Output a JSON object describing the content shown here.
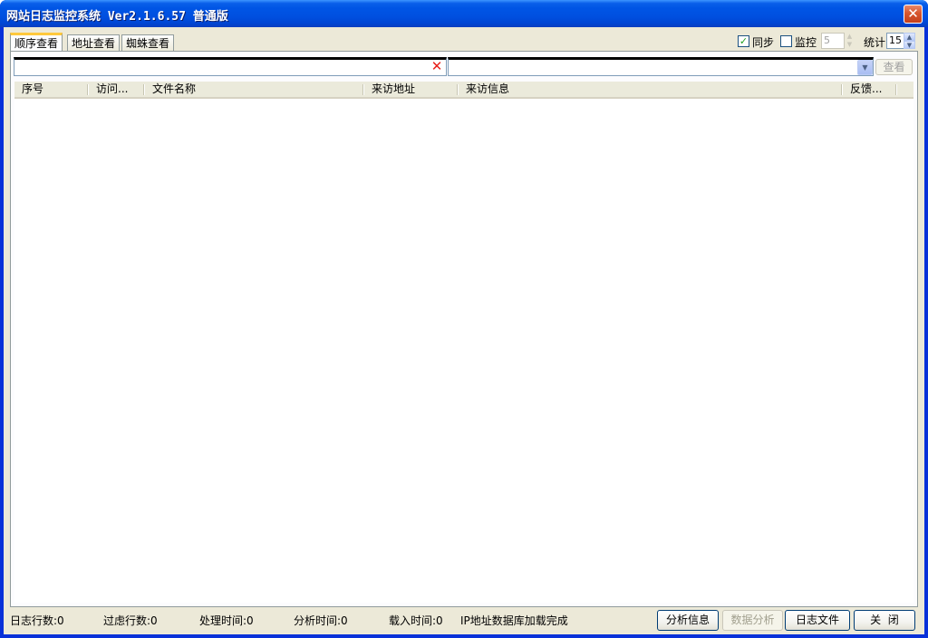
{
  "window": {
    "title": "网站日志监控系统 Ver2.1.6.57 普通版",
    "close_glyph": "✕"
  },
  "tabs": [
    {
      "label": "顺序查看",
      "active": true
    },
    {
      "label": "地址查看",
      "active": false
    },
    {
      "label": "蜘蛛查看",
      "active": false
    }
  ],
  "options": {
    "sync_label": "同步",
    "sync_checked": true,
    "monitor_label": "监控",
    "monitor_checked": false,
    "monitor_value": "5",
    "stats_label": "统计",
    "stats_value": "15"
  },
  "search": {
    "input_value": "",
    "clear_glyph": "✕",
    "combo_value": "",
    "combo_arrow": "▼",
    "view_button": "查看"
  },
  "columns": [
    "序号",
    "访问...",
    "文件名称",
    "来访地址",
    "来访信息",
    "反馈..."
  ],
  "status": {
    "log_rows": "日志行数:0",
    "filtered_rows": "过虑行数:0",
    "process_time": "处理时间:0",
    "analysis_time": "分析时间:0",
    "load_time": "载入时间:0",
    "message": "IP地址数据库加载完成"
  },
  "buttons": {
    "analyze_info": "分析信息",
    "data_analysis": "数据分析",
    "log_file": "日志文件",
    "close": "关  闭"
  },
  "colors": {
    "title_bar": "#0055e5",
    "window_bg": "#ece9d8",
    "tab_highlight": "#ffc83c",
    "close_button": "#d8572e"
  }
}
